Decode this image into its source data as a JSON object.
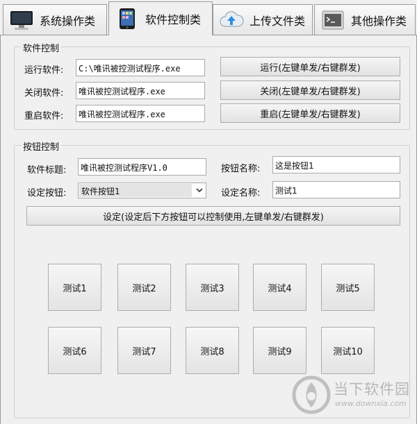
{
  "tabs": [
    {
      "label": "系统操作类",
      "icon": "monitor-icon"
    },
    {
      "label": "软件控制类",
      "icon": "tablet-icon"
    },
    {
      "label": "上传文件类",
      "icon": "cloud-upload-icon"
    },
    {
      "label": "其他操作类",
      "icon": "terminal-icon"
    }
  ],
  "software_control": {
    "legend": "软件控制",
    "run_label": "运行软件:",
    "run_value": "C:\\唯讯被控测试程序.exe",
    "run_button": "运行(左键单发/右键群发)",
    "close_label": "关闭软件:",
    "close_value": "唯讯被控测试程序.exe",
    "close_button": "关闭(左键单发/右键群发)",
    "restart_label": "重启软件:",
    "restart_value": "唯讯被控测试程序.exe",
    "restart_button": "重启(左键单发/右键群发)"
  },
  "button_control": {
    "legend": "按钮控制",
    "title_label": "软件标题:",
    "title_value": "唯讯被控测试程序V1.0",
    "name_label": "按钮名称:",
    "name_value": "这是按钮1",
    "set_button_label": "设定按钮:",
    "set_button_value": "软件按钮1",
    "set_name_label": "设定名称:",
    "set_name_value": "测试1",
    "apply_button": "设定(设定后下方按钮可以控制使用,左键单发/右键群发)"
  },
  "test_buttons": [
    "测试1",
    "测试2",
    "测试3",
    "测试4",
    "测试5",
    "测试6",
    "测试7",
    "测试8",
    "测试9",
    "测试10"
  ],
  "watermark": {
    "title": "当下软件园",
    "url": "www.downxia.com"
  }
}
